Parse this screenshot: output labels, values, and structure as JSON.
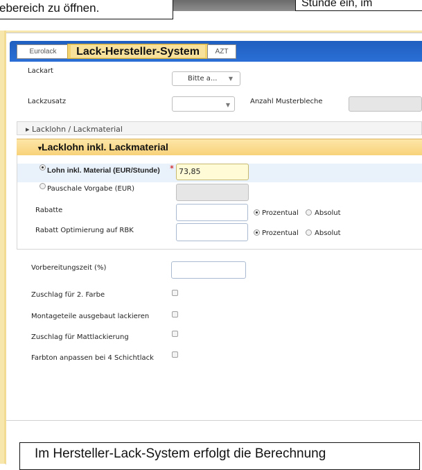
{
  "callouts": {
    "top_left": "ebereich zu öffnen.",
    "top_right": "Stunde ein, im",
    "bottom": "Im Hersteller-Lack-System erfolgt die Berechnung"
  },
  "tabs": [
    {
      "label": "Eurolack"
    },
    {
      "label": "Lack-Hersteller-System"
    },
    {
      "label": "AZT"
    }
  ],
  "form": {
    "lackart": {
      "label": "Lackart",
      "value": "Bitte a..."
    },
    "lackzusatz": {
      "label": "Lackzusatz",
      "value": ""
    },
    "anzahl_musterbleche": {
      "label": "Anzahl Musterbleche",
      "value": ""
    }
  },
  "sections": {
    "collapsed": {
      "title": "Lacklohn / Lackmaterial"
    },
    "open": {
      "title": "Lacklohn inkl. Lackmaterial"
    }
  },
  "lohn": {
    "option1_label": "Lohn inkl. Material (EUR/Stunde)",
    "option1_value": "73,85",
    "required_mark": "*",
    "option2_label": "Pauschale Vorgabe (EUR)",
    "option2_value": ""
  },
  "rabatte": {
    "label": "Rabatte",
    "value": "",
    "radio_prozentual": "Prozentual",
    "radio_absolut": "Absolut"
  },
  "rabatt_opt": {
    "label": "Rabatt Optimierung auf RBK",
    "value": "",
    "radio_prozentual": "Prozentual",
    "radio_absolut": "Absolut"
  },
  "vorbereitung": {
    "label": "Vorbereitungszeit (%)",
    "value": ""
  },
  "checkboxes": [
    {
      "label": "Zuschlag für 2. Farbe",
      "checked": false
    },
    {
      "label": "Montageteile ausgebaut lackieren",
      "checked": false
    },
    {
      "label": "Zuschlag für Mattlackierung",
      "checked": false
    },
    {
      "label": "Farbton anpassen bei 4 Schichtlack",
      "checked": false
    }
  ],
  "icons": {
    "collapsed_arrow": "▸",
    "open_arrow": "▾",
    "dropdown": "▼"
  },
  "colors": {
    "tab_active": "#f3d36f",
    "tabbar": "#2b6fd6",
    "section_header": "#f8d27a",
    "required": "#cc0000"
  }
}
